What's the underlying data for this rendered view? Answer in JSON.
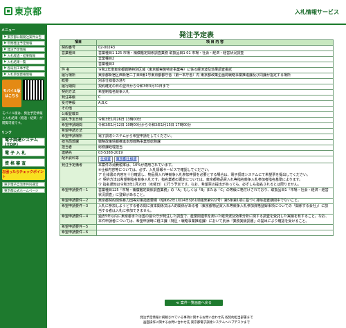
{
  "header": {
    "logo_text": "東京都",
    "service_title": "入札情報サービス"
  },
  "sidebar": {
    "menu_heading": "メニュー",
    "items": [
      {
        "label": "東京都公報発注案件公告"
      },
      {
        "label": "年間発注予定情報"
      },
      {
        "label": "発注予定情報"
      },
      {
        "label": "入札経過・結果情報"
      },
      {
        "label": "入札結果一覧"
      },
      {
        "label": "各局別工事予定"
      },
      {
        "label": "入札参加資格情報"
      }
    ],
    "mobile_btn": "モバイル版はこちら",
    "mobile_note": "モバイル版は、発注予定情報と入札結果（経過・結果）が閲覧可能です。",
    "links_heading": "リンク",
    "big_buttons": [
      {
        "label": "電子調達システム(TOP)"
      },
      {
        "label": "電 子 入 札"
      },
      {
        "label": "資 格 審 査"
      }
    ],
    "promo": "お困ったらチェックポイント",
    "footer_links": [
      {
        "label": "東京電子自治体共同運営"
      },
      {
        "label": "東京都公式ホームページ"
      }
    ]
  },
  "main": {
    "title": "発注予定表",
    "col_item": "項目",
    "col_content": "項 目 内 容",
    "rows": [
      {
        "label": "契約番号",
        "value": "02-00243"
      },
      {
        "label": "営業種目",
        "value": "営業種目1 125 市場・補償鑑定関係調査業務 取扱品目1 01 市場・社会・経済・経営状況調査"
      },
      {
        "label": "",
        "value": "営業種目2"
      },
      {
        "label": "",
        "value": "営業種目3"
      },
      {
        "label": "件 名",
        "value": "令和2年度東京都戦略特別区域（東京都実施特定事業等）に係る経済波及効果調査委託"
      },
      {
        "label": "履行場所",
        "value": "東京都新宿区西新宿二丁目8番1号東京都都庁舎（第一本庁舎）内 東京都政策企画局戦略事業推進課及び同課が指定する場所"
      },
      {
        "label": "概要",
        "value": "別添仕様書の通り"
      },
      {
        "label": "履行期間",
        "value": "契約確定の日の翌日から令和3年3月31日まで"
      },
      {
        "label": "契約方法",
        "value": "希望制指名競争入札"
      },
      {
        "label": "発注等級",
        "value": "C"
      },
      {
        "label": "受付等級",
        "value": "A,B,C"
      },
      {
        "label": "その他",
        "value": ""
      },
      {
        "label": "公報登載日",
        "value": ""
      },
      {
        "label": "開札予定日時",
        "value": "令和3年1月26日 13時00分"
      },
      {
        "label": "希望申請期間",
        "value": "令和3年1月12日 10時00分から令和3年1月15日 17時00分"
      },
      {
        "label": "希望申請方法",
        "value": ""
      },
      {
        "label": "希望申請場所",
        "value": "電子調達システムから希望申請をしてください。"
      },
      {
        "label": "担当局部課",
        "value": "戦略政策情報推進本部戦略事業部総務課"
      },
      {
        "label": "担当者",
        "value": "総務課経理担当"
      },
      {
        "label": "連絡先",
        "value": "03-5388-2019"
      }
    ],
    "attach_label": "配布資料等",
    "attach_files": [
      "仕様書",
      "東京都仕様書"
    ],
    "notes_label": "発注予定備考",
    "notes": [
      "本案件の消費税率は、10%が適用されています。",
      "※仕様内容等については、必ず、入札情報サービスで確認してください。",
      "ア 仕様書の内容を十分確認し、物品買入れ等競争入札参加申請を必要とする場合は、電子調達システムにて希望票を提出してください。",
      "イ 契約方法は希望制指名競争入札です。指名業者の選定については、東京都物品買入れ等指名競争入札参加者指名基準によります。",
      "ウ 指名通知は令和3年1月20日（水曜日）に行う予定です。なお、希望票の提出があっても、必ずしも指名されるとは限りません。"
    ],
    "req_rows": [
      {
        "label": "希望申請要件－1",
        "value": "営業種目125「市場・補償鑑定関係調査業務」の「A」もしくは「B」または「C」の等級に格付けされており、取扱品目1「市場・社会・経済・経営状況調査」に登録があること。"
      },
      {
        "label": "希望申請要件－2",
        "value": "東京都契約関係暴力団等対策措置要綱（昭和62年1月14日付61財経庶第922号）第5条第1項に基づく排除措置期間中でないこと。"
      },
      {
        "label": "希望申請要件－3",
        "value": "入札に参加しようとする者の間に資本関係又は人的関係がある者（東京都物品買入れ等競争入札参加資格登録事項についての「関係する会社」）に該当する者は入札に参加できません。"
      },
      {
        "label": "希望申請要件－4",
        "value": "過去5年以内に東京都または国の官公庁が発注した調査で、産業関連表を用いた経済波及効果分析に関する調査を受託した実績を有すること。なお、本件申請者については、希望申請時に経工課（特区・戦略事業推進課）において別添「業務実績調書」の提出により確認を受けること。"
      },
      {
        "label": "希望申請要件－5",
        "value": ""
      },
      {
        "label": "希望申請要件－6",
        "value": ""
      }
    ],
    "back_button": "≪ 案件一覧画面へ戻る",
    "footer_lines": [
      "発注予定情報に掲載されている事項に関するお問い合わせ先 各契約担当部署まで",
      "画面操作に関するお問い合わせ先 東京都電子調達システムヘルプデスクまで"
    ]
  }
}
